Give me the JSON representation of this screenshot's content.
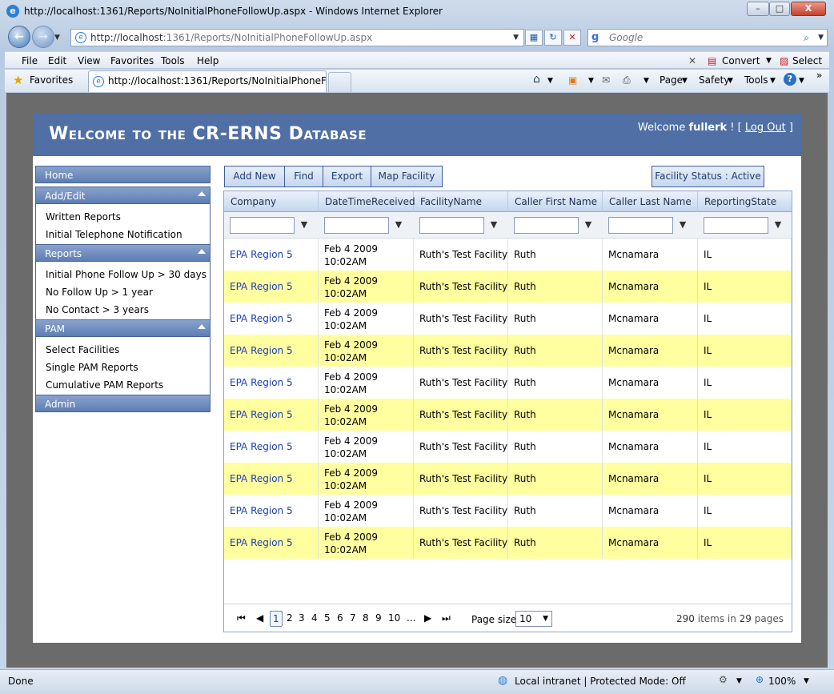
{
  "window": {
    "title": "http://localhost:1361/Reports/NoInitialPhoneFollowUp.aspx - Windows Internet Explorer",
    "minimize": "–",
    "maximize": "□",
    "close": "X"
  },
  "address": {
    "url_host": "http://localhost",
    "url_rest": ":1361/Reports/NoInitialPhoneFollowUp.aspx",
    "search_placeholder": "Google"
  },
  "menu": [
    "File",
    "Edit",
    "View",
    "Favorites",
    "Tools",
    "Help"
  ],
  "menu_right": {
    "convert": "Convert",
    "select": "Select"
  },
  "favorites": {
    "label": "Favorites",
    "tab_title": "http://localhost:1361/Reports/NoInitialPhoneFoll..."
  },
  "commands": {
    "page": "Page",
    "safety": "Safety",
    "tools": "Tools"
  },
  "banner": {
    "title": "Welcome to the CR-ERNS Database",
    "welcome_prefix": "Welcome ",
    "user": "fullerk",
    "welcome_mid": " ! [ ",
    "logout": "Log Out",
    "welcome_end": " ]"
  },
  "sidebar": {
    "home": "Home",
    "add_edit": {
      "label": "Add/Edit",
      "items": [
        "Written Reports",
        "Initial Telephone Notification"
      ]
    },
    "reports": {
      "label": "Reports",
      "items": [
        "Initial Phone Follow Up > 30 days",
        "No Follow Up > 1 year",
        "No Contact > 3 years"
      ]
    },
    "pam": {
      "label": "PAM",
      "items": [
        "Select Facilities",
        "Single PAM Reports",
        "Cumulative PAM Reports"
      ]
    },
    "admin": "Admin"
  },
  "toolbar": {
    "add_new": "Add New",
    "find": "Find",
    "export": "Export",
    "map_facility": "Map Facility",
    "facility_status": "Facility Status : Active"
  },
  "grid": {
    "columns": [
      "Company",
      "DateTimeReceived",
      "FacilityName",
      "Caller First Name",
      "Caller Last Name",
      "ReportingState"
    ],
    "rows": [
      {
        "company": "EPA Region 5",
        "date": "Feb 4 2009",
        "time": "10:02AM",
        "facility": "Ruth's Test Facility",
        "first": "Ruth",
        "last": "Mcnamara",
        "state": "IL"
      },
      {
        "company": "EPA Region 5",
        "date": "Feb 4 2009",
        "time": "10:02AM",
        "facility": "Ruth's Test Facility",
        "first": "Ruth",
        "last": "Mcnamara",
        "state": "IL"
      },
      {
        "company": "EPA Region 5",
        "date": "Feb 4 2009",
        "time": "10:02AM",
        "facility": "Ruth's Test Facility",
        "first": "Ruth",
        "last": "Mcnamara",
        "state": "IL"
      },
      {
        "company": "EPA Region 5",
        "date": "Feb 4 2009",
        "time": "10:02AM",
        "facility": "Ruth's Test Facility",
        "first": "Ruth",
        "last": "Mcnamara",
        "state": "IL"
      },
      {
        "company": "EPA Region 5",
        "date": "Feb 4 2009",
        "time": "10:02AM",
        "facility": "Ruth's Test Facility",
        "first": "Ruth",
        "last": "Mcnamara",
        "state": "IL"
      },
      {
        "company": "EPA Region 5",
        "date": "Feb 4 2009",
        "time": "10:02AM",
        "facility": "Ruth's Test Facility",
        "first": "Ruth",
        "last": "Mcnamara",
        "state": "IL"
      },
      {
        "company": "EPA Region 5",
        "date": "Feb 4 2009",
        "time": "10:02AM",
        "facility": "Ruth's Test Facility",
        "first": "Ruth",
        "last": "Mcnamara",
        "state": "IL"
      },
      {
        "company": "EPA Region 5",
        "date": "Feb 4 2009",
        "time": "10:02AM",
        "facility": "Ruth's Test Facility",
        "first": "Ruth",
        "last": "Mcnamara",
        "state": "IL"
      },
      {
        "company": "EPA Region 5",
        "date": "Feb 4 2009",
        "time": "10:02AM",
        "facility": "Ruth's Test Facility",
        "first": "Ruth",
        "last": "Mcnamara",
        "state": "IL"
      },
      {
        "company": "EPA Region 5",
        "date": "Feb 4 2009",
        "time": "10:02AM",
        "facility": "Ruth's Test Facility",
        "first": "Ruth",
        "last": "Mcnamara",
        "state": "IL"
      }
    ]
  },
  "pager": {
    "pages": [
      "1",
      "2",
      "3",
      "4",
      "5",
      "6",
      "7",
      "8",
      "9",
      "10",
      "..."
    ],
    "current": "1",
    "page_size_label": "Page size:",
    "page_size": "10",
    "total_items": "290",
    "items_in": " items in ",
    "total_pages": "29",
    "pages_word": " pages"
  },
  "status": {
    "left": "Done",
    "zone": "Local intranet | Protected Mode: Off",
    "zoom": "100%"
  },
  "colors": {
    "banner": "#4f6fa5",
    "alt_row": "#ffff9f",
    "link": "#1b3fb8"
  }
}
